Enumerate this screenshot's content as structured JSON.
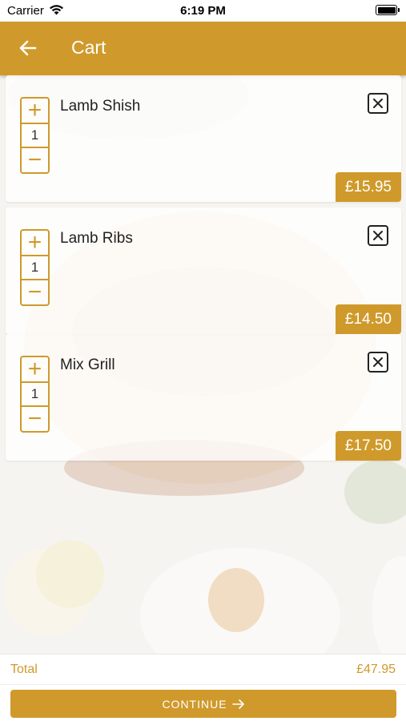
{
  "status_bar": {
    "carrier": "Carrier",
    "time": "6:19 PM"
  },
  "header": {
    "title": "Cart",
    "back_icon": "arrow-left-icon"
  },
  "cart": {
    "items": [
      {
        "name": "Lamb Shish",
        "quantity": "1",
        "price": "£15.95",
        "increment": "+",
        "decrement": "−"
      },
      {
        "name": "Lamb Ribs",
        "quantity": "1",
        "price": "£14.50",
        "increment": "+",
        "decrement": "−"
      },
      {
        "name": "Mix Grill",
        "quantity": "1",
        "price": "£17.50",
        "increment": "+",
        "decrement": "−"
      }
    ]
  },
  "footer": {
    "total_label": "Total",
    "total_value": "£47.95",
    "continue_label": "CONTINUE"
  },
  "colors": {
    "accent": "#cf9a2b",
    "text": "#222222",
    "background": "#ffffff"
  }
}
